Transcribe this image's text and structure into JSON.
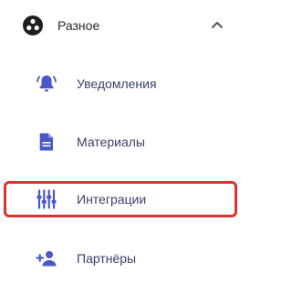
{
  "section": {
    "label": "Разное",
    "icon": "dots-circle-icon",
    "expanded": true
  },
  "items": [
    {
      "label": "Уведомления",
      "icon": "bell-icon"
    },
    {
      "label": "Материалы",
      "icon": "document-icon"
    },
    {
      "label": "Интеграции",
      "icon": "sliders-icon",
      "highlighted": true
    },
    {
      "label": "Партнёры",
      "icon": "add-user-icon"
    }
  ],
  "colors": {
    "icon": "#4a57c9",
    "text": "#3a3f6b",
    "header_text": "#2b2b2b",
    "highlight_border": "#e03030"
  }
}
